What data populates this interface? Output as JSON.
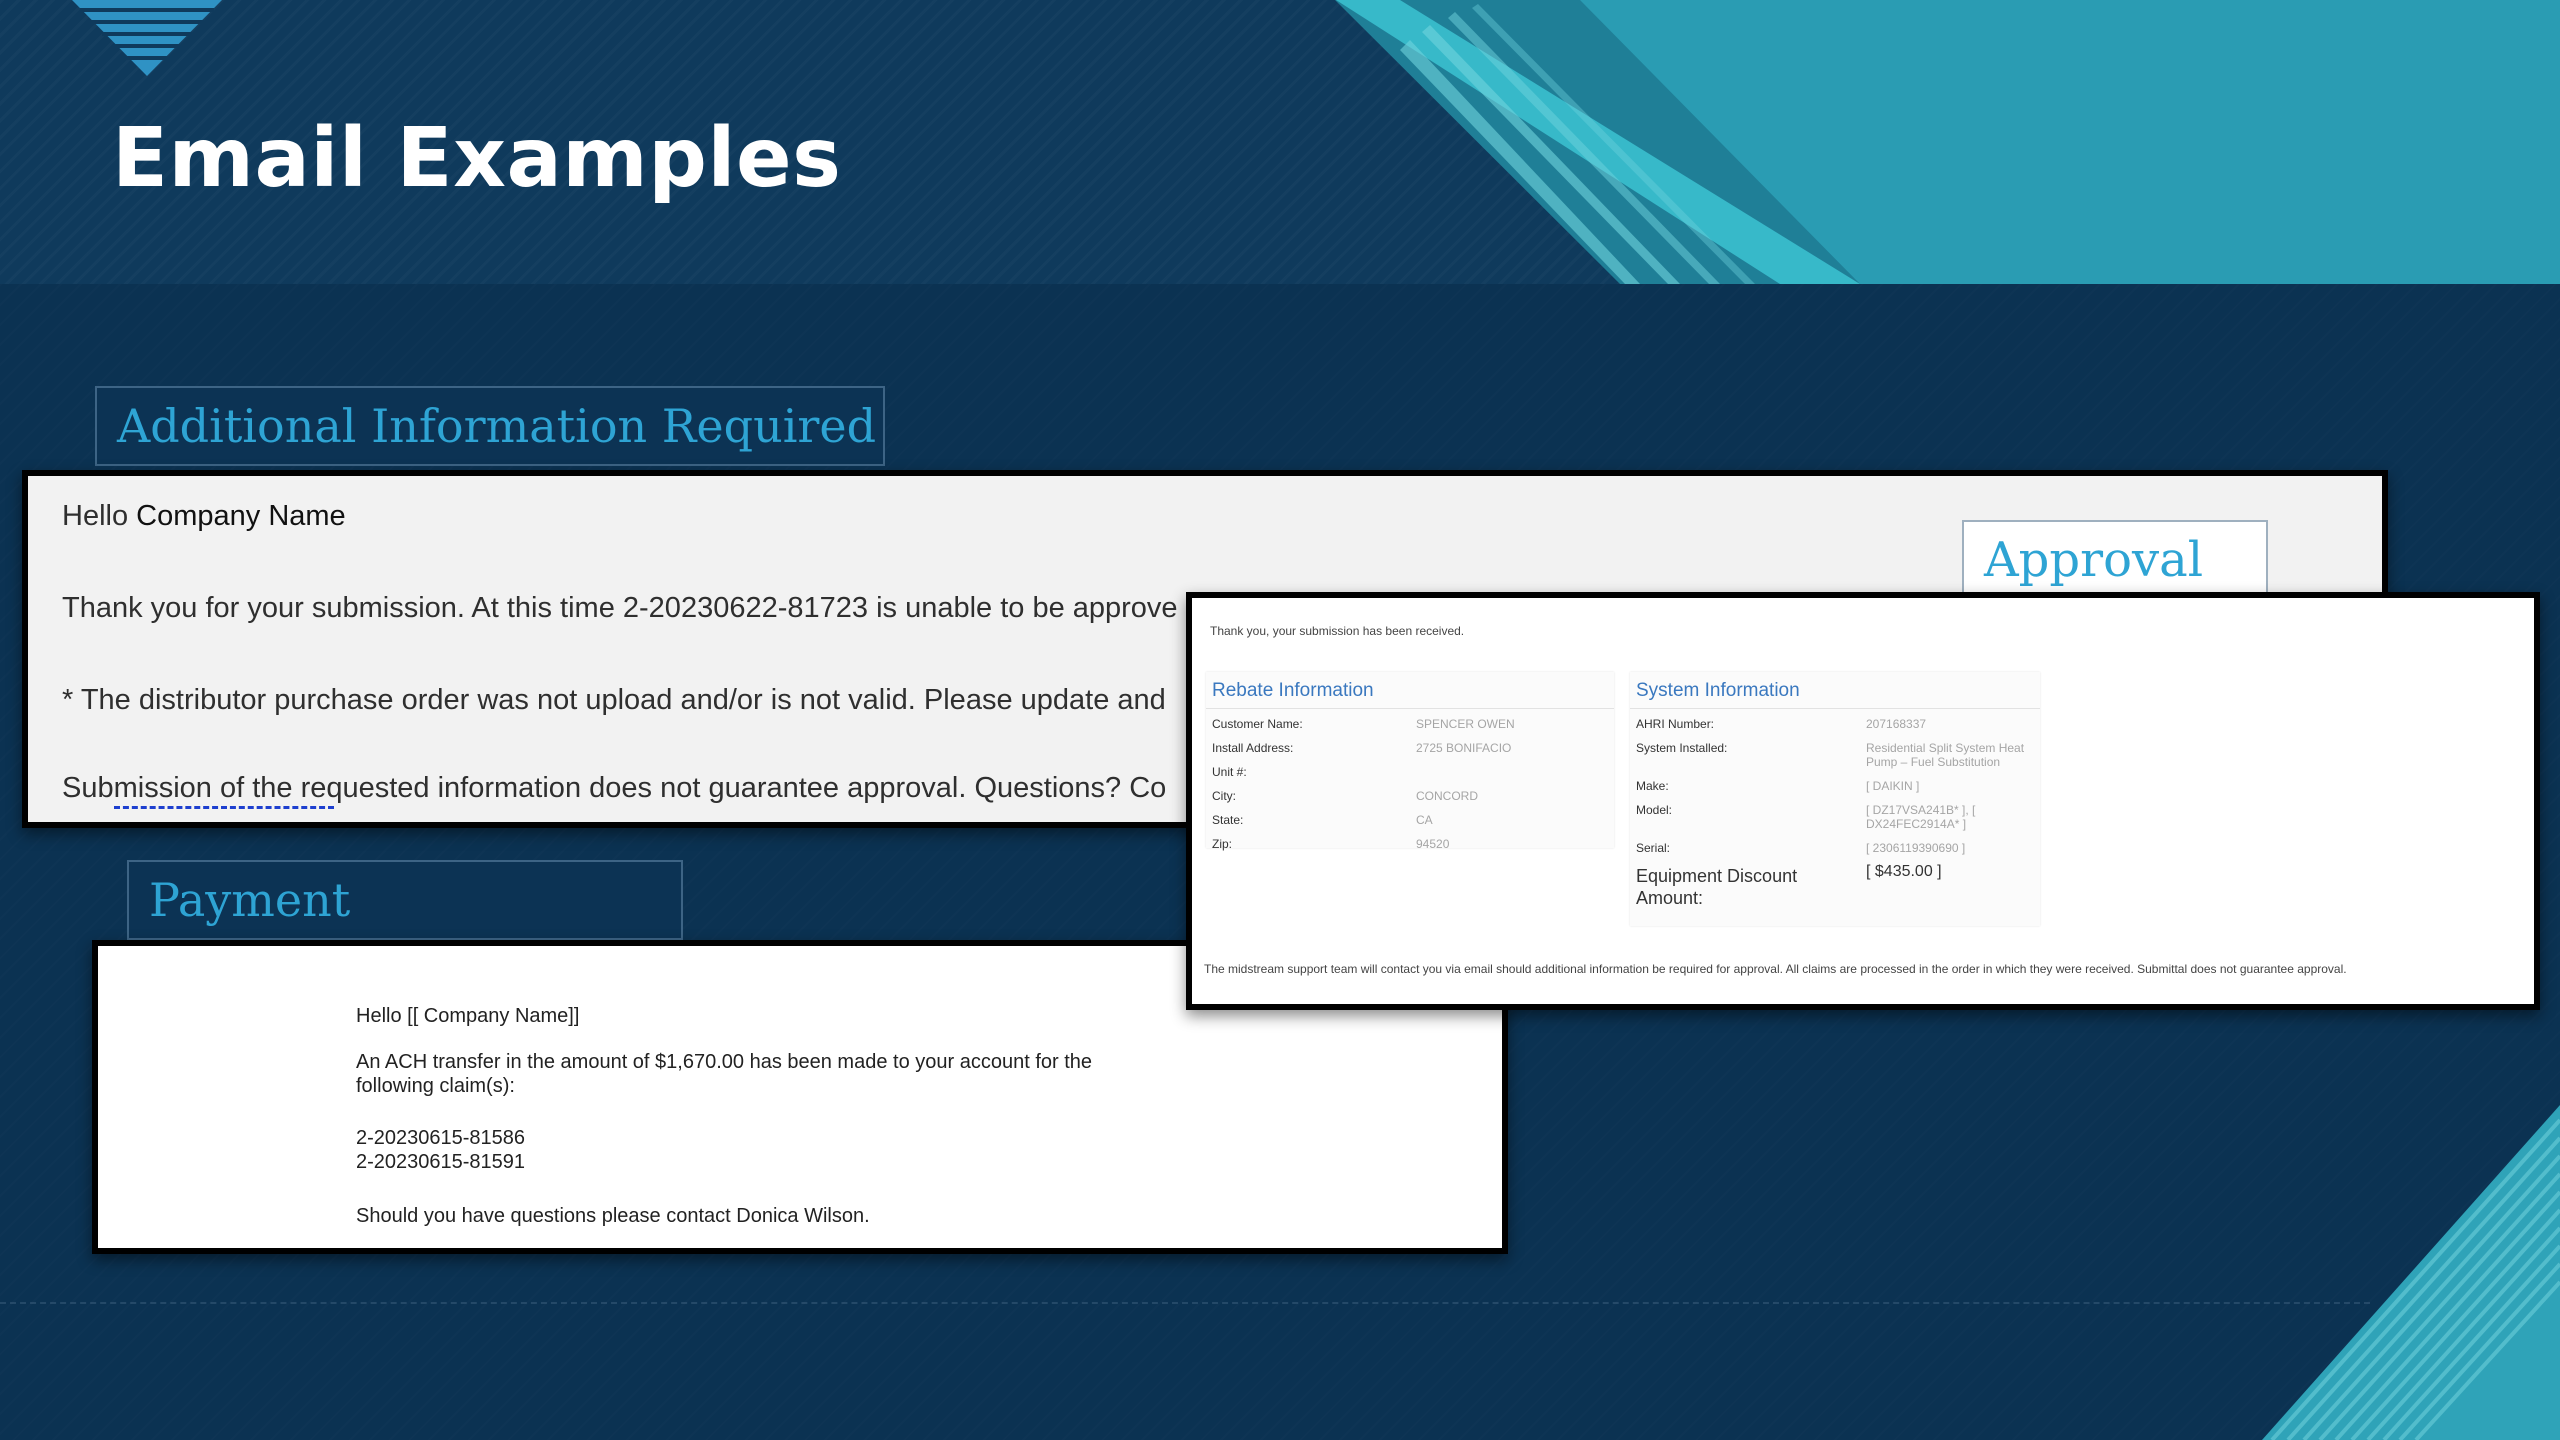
{
  "slide": {
    "title": "Email Examples"
  },
  "colors": {
    "background": "#0b3252",
    "header": "#0f3a5c",
    "accent_teal": "#2fa3b8",
    "label_text": "#2ea4d4"
  },
  "labels": {
    "additional_info": "Additional Information Required",
    "approval": "Approval",
    "payment": "Payment"
  },
  "additional_email": {
    "greeting_prefix": "Hello",
    "company": "Company Name",
    "line1": "Thank you for your submission. At this time 2-20230622-81723 is unable to be approve",
    "line2": "* The distributor purchase order was not upload and/or is not valid. Please update and",
    "line3": "Submission of the requested information does not guarantee approval. Questions? Co"
  },
  "payment_email": {
    "greeting": "Hello [[ Company Name]]",
    "line1": "An ACH transfer in the amount of $1,670.00 has been made to your account for the",
    "line2": "following claim(s):",
    "claim1": "2-20230615-81586",
    "claim2": "2-20230615-81591",
    "contact": "Should you have questions please contact Donica Wilson."
  },
  "approval_email": {
    "thanks": "Thank you, your submission has been received.",
    "rebate": {
      "title": "Rebate Information",
      "rows": [
        {
          "label": "Customer Name:",
          "value": "SPENCER OWEN"
        },
        {
          "label": "Install Address:",
          "value": "2725 BONIFACIO"
        },
        {
          "label": "Unit #:",
          "value": ""
        },
        {
          "label": "City:",
          "value": "CONCORD"
        },
        {
          "label": "State:",
          "value": "CA"
        },
        {
          "label": "Zip:",
          "value": "94520"
        }
      ]
    },
    "system": {
      "title": "System Information",
      "rows": [
        {
          "label": "AHRI Number:",
          "value": "207168337"
        },
        {
          "label": "System Installed:",
          "value": "Residential Split System Heat Pump – Fuel Substitution"
        },
        {
          "label": "Make:",
          "value": "[ DAIKIN ]"
        },
        {
          "label": "Model:",
          "value": "[ DZ17VSA241B* ], [ DX24FEC2914A* ]"
        },
        {
          "label": "Serial:",
          "value": "[ 2306119390690 ]"
        }
      ],
      "discount_label": "Equipment Discount Amount:",
      "discount_value": "[ $435.00 ]"
    },
    "footer": "The midstream support team will contact you via email should additional information be required for approval. All claims are processed in the order in which they were received. Submittal does not guarantee approval."
  }
}
